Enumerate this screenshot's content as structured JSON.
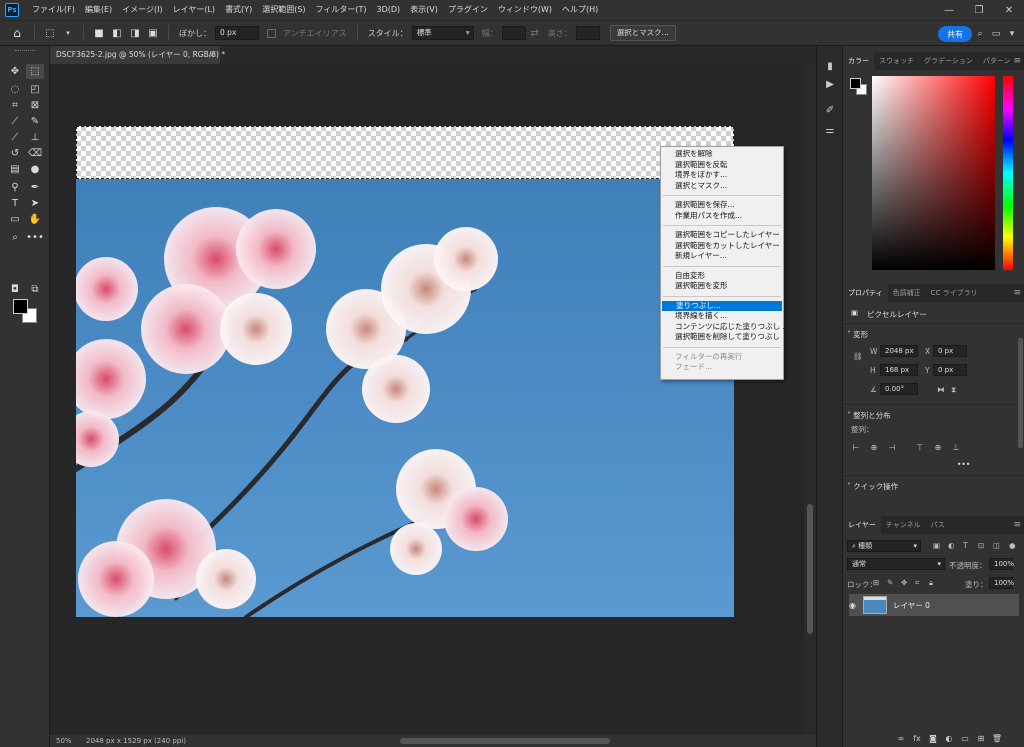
{
  "app": {
    "logo": "Ps"
  },
  "menubar": {
    "items": [
      "ファイル(F)",
      "編集(E)",
      "イメージ(I)",
      "レイヤー(L)",
      "書式(Y)",
      "選択範囲(S)",
      "フィルター(T)",
      "3D(D)",
      "表示(V)",
      "プラグイン",
      "ウィンドウ(W)",
      "ヘルプ(H)"
    ],
    "window_controls": [
      "—",
      "❐",
      "✕"
    ]
  },
  "options": {
    "feather_label": "ぼかし：",
    "feather_value": "0 px",
    "antialias_label": "アンチエイリアス",
    "style_label": "スタイル：",
    "style_value": "標準",
    "width_label": "幅：",
    "height_label": "高さ：",
    "select_mask_button": "選択とマスク...",
    "share_button": "共有"
  },
  "document": {
    "tab_title": "DSCF3625-2.jpg @ 50% (レイヤー 0, RGB/8) *",
    "close": "×"
  },
  "status": {
    "zoom": "50%",
    "info": "2048 px x 1529 px (240 ppi)"
  },
  "context_menu": {
    "groups": [
      [
        "選択を解除",
        "選択範囲を反転",
        "境界をぼかす...",
        "選択とマスク..."
      ],
      [
        "選択範囲を保存...",
        "作業用パスを作成..."
      ],
      [
        "選択範囲をコピーしたレイヤー",
        "選択範囲をカットしたレイヤー",
        "新規レイヤー..."
      ],
      [
        "自由変形",
        "選択範囲を変形"
      ],
      [
        "塗りつぶし...",
        "境界線を描く...",
        "コンテンツに応じた塗りつぶし ...",
        "選択範囲を削除して塗りつぶし"
      ],
      [
        "フィルターの再実行",
        "フェード..."
      ]
    ],
    "highlighted": "塗りつぶし..."
  },
  "color_panel": {
    "tabs": [
      "カラー",
      "スウォッチ",
      "グラデーション",
      "パターン"
    ],
    "foreground": "#000000",
    "background": "#ffffff",
    "hue": "#ff0000"
  },
  "properties_panel": {
    "tabs": [
      "プロパティ",
      "色調補正",
      "CC ライブラリ"
    ],
    "layer_type": "ピクセルレイヤー",
    "transform_title": "変形",
    "w_label": "W",
    "w_value": "2048 px",
    "h_label": "H",
    "h_value": "168 px",
    "x_label": "X",
    "x_value": "0 px",
    "y_label": "Y",
    "y_value": "0 px",
    "angle_value": "0.00°",
    "align_title": "整列と分布",
    "align_label": "整列：",
    "more": "•••",
    "quick_title": "クイック操作"
  },
  "layers_panel": {
    "tabs": [
      "レイヤー",
      "チャンネル",
      "パス"
    ],
    "filter_value": "種類",
    "blend_mode": "通常",
    "opacity_label": "不透明度：",
    "opacity_value": "100%",
    "lock_label": "ロック：",
    "fill_label": "塗り：",
    "fill_value": "100%",
    "layer_name": "レイヤー 0"
  }
}
